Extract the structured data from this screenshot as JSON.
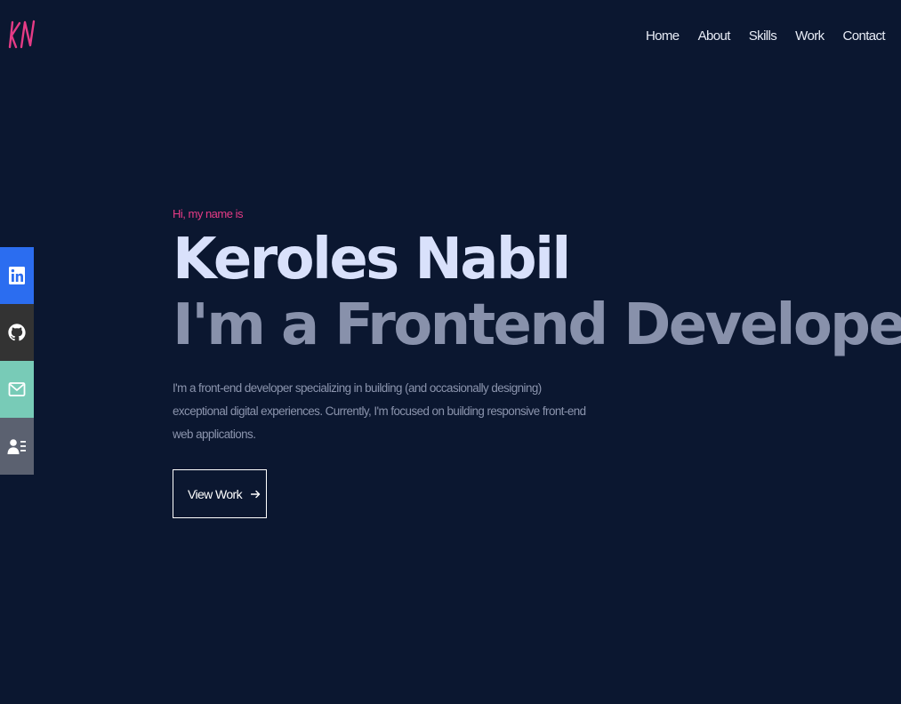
{
  "logo": {
    "text": "KN",
    "color": "#e63b86"
  },
  "nav": {
    "items": [
      {
        "label": "Home"
      },
      {
        "label": "About"
      },
      {
        "label": "Skills"
      },
      {
        "label": "Work"
      },
      {
        "label": "Contact"
      }
    ]
  },
  "social": {
    "items": [
      {
        "icon": "linkedin-icon",
        "color": "#2b6df0"
      },
      {
        "icon": "github-icon",
        "color": "#333333"
      },
      {
        "icon": "mail-icon",
        "color": "#78cbb7"
      },
      {
        "icon": "contact-card-icon",
        "color": "#5b6170"
      }
    ]
  },
  "hero": {
    "greeting": "Hi, my name is",
    "name": "Keroles Nabil",
    "role": "I'm a Frontend Developer.",
    "bio": "I'm a front-end developer specializing in building (and occasionally designing) exceptional digital experiences. Currently, I'm focused on building responsive front-end web applications.",
    "cta_label": "View Work",
    "cta_icon": "arrow-right-icon"
  },
  "colors": {
    "background": "#0b1730",
    "accent": "#e63b86",
    "name_text": "#d9e1fb",
    "role_text": "#8891ab",
    "body_text": "#8b94ad"
  }
}
